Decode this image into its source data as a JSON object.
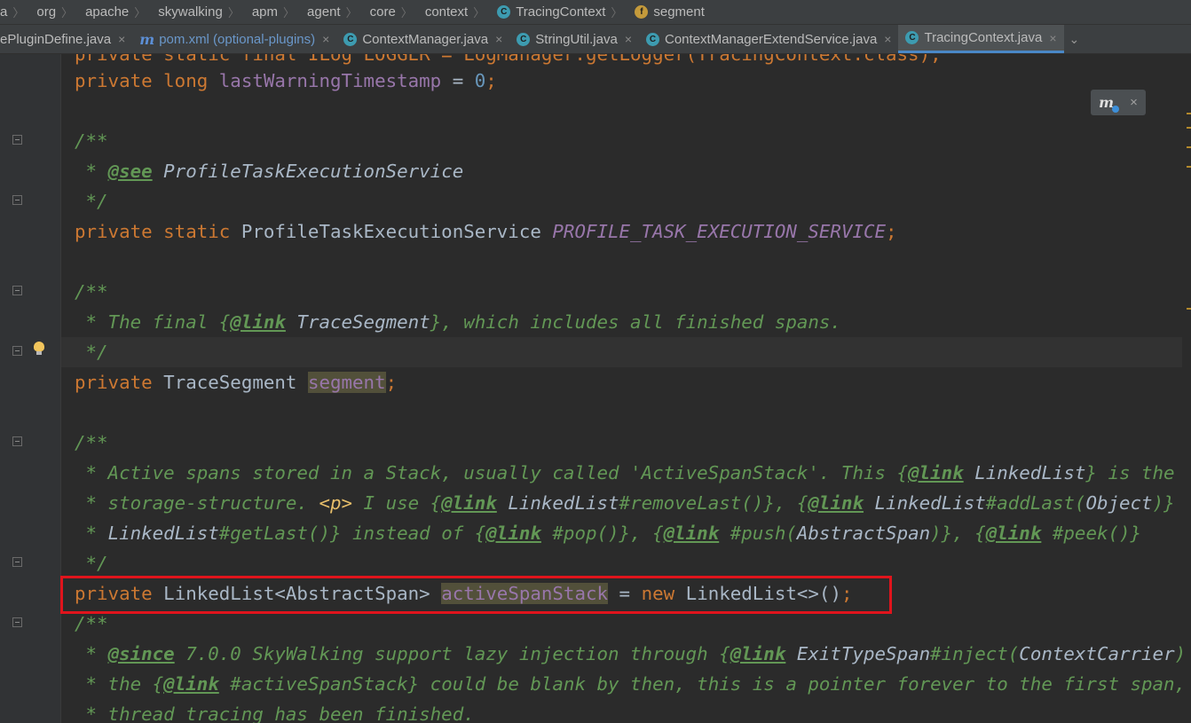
{
  "breadcrumb": [
    {
      "label": "a",
      "icon": null
    },
    {
      "label": "org",
      "icon": null
    },
    {
      "label": "apache",
      "icon": null
    },
    {
      "label": "skywalking",
      "icon": null
    },
    {
      "label": "apm",
      "icon": null
    },
    {
      "label": "agent",
      "icon": null
    },
    {
      "label": "core",
      "icon": null
    },
    {
      "label": "context",
      "icon": null
    },
    {
      "label": "TracingContext",
      "icon": "class-icon",
      "icon_letter": "C"
    },
    {
      "label": "segment",
      "icon": "field-icon",
      "icon_letter": "f"
    }
  ],
  "tabs": [
    {
      "label": "ePluginDefine.java",
      "icon": null,
      "active": false
    },
    {
      "label": "pom.xml (optional-plugins)",
      "icon": "maven-icon",
      "icon_letter": "m",
      "active": false
    },
    {
      "label": "ContextManager.java",
      "icon": "class-icon",
      "icon_letter": "C",
      "active": false
    },
    {
      "label": "StringUtil.java",
      "icon": "class-icon",
      "icon_letter": "C",
      "active": false
    },
    {
      "label": "ContextManagerExtendService.java",
      "icon": "class-icon",
      "icon_letter": "C",
      "active": false
    },
    {
      "label": "TracingContext.java",
      "icon": "class-icon",
      "icon_letter": "C",
      "active": true
    }
  ],
  "tab_close_glyph": "×",
  "tab_more_glyph": "⌄",
  "maven_popup": {
    "icon": "m",
    "close": "×"
  },
  "colors": {
    "keyword": "#cc7832",
    "javadoc": "#629755",
    "field": "#9876aa",
    "number": "#6897bb",
    "text": "#a9b7c6",
    "highlight_box": "#e0141c"
  },
  "code": {
    "l0a": "private static final ILog LOGGER = LogManager.getLogger(TracingContext.class);",
    "l1_kw": "private long ",
    "l1_field": "lastWarningTimestamp",
    "l1_eq": " = ",
    "l1_num": "0",
    "l1_end": ";",
    "l3": "/**",
    "l4_pre": " * ",
    "l4_tag": "@see",
    "l4_ref": " ProfileTaskExecutionService",
    "l5": " */",
    "l6_kw": "private static ",
    "l6_type": "ProfileTaskExecutionService ",
    "l6_field": "PROFILE_TASK_EXECUTION_SERVICE",
    "l6_end": ";",
    "l8": "/**",
    "l9_a": " * The final {",
    "l9_tag": "@link",
    "l9_ref": " TraceSegment",
    "l9_b": "}, which includes all finished spans.",
    "l10": " */",
    "l11_kw": "private ",
    "l11_type": "TraceSegment ",
    "l11_field": "segment",
    "l11_end": ";",
    "l13": "/**",
    "l14_a": " * Active spans stored in a Stack, usually called 'ActiveSpanStack'. This {",
    "l14_tag": "@link",
    "l14_ref": " LinkedList",
    "l14_b": "} is the in-thread",
    "l15_a": " * storage-structure. ",
    "l15_html": "<p>",
    "l15_b": " I use {",
    "l15_tag1": "@link",
    "l15_ref1": " LinkedList",
    "l15_c": "#removeLast()}, {",
    "l15_tag2": "@link",
    "l15_ref2": " LinkedList",
    "l15_d": "#addLast(",
    "l15_ref3": "Object",
    "l15_e": ")} and",
    "l16_a": " * ",
    "l16_ref1": "LinkedList",
    "l16_b": "#getLast()} instead of {",
    "l16_tag1": "@link",
    "l16_c": " #pop()}, {",
    "l16_tag2": "@link",
    "l16_d": " #push(",
    "l16_ref2": "AbstractSpan",
    "l16_e": ")}, {",
    "l16_tag3": "@link",
    "l16_f": " #peek()}",
    "l17": " */",
    "l18_kw": "private ",
    "l18_type": "LinkedList<AbstractSpan> ",
    "l18_field": "activeSpanStack",
    "l18_eq": " = ",
    "l18_new": "new ",
    "l18_ctor": "LinkedList<>()",
    "l18_end": ";",
    "l19": "/**",
    "l20_a": " * ",
    "l20_tag": "@since",
    "l20_b": " 7.0.0 SkyWalking support lazy injection through {",
    "l20_tag2": "@link",
    "l20_ref": " ExitTypeSpan",
    "l20_c": "#inject(",
    "l20_ref2": "ContextCarrier",
    "l20_d": ")}. So",
    "l21_a": " * the {",
    "l21_tag": "@link",
    "l21_b": " #activeSpanStack} could be blank by then, this is a pointer forever to the first span, even the",
    "l22": " * thread tracing has been finished."
  }
}
